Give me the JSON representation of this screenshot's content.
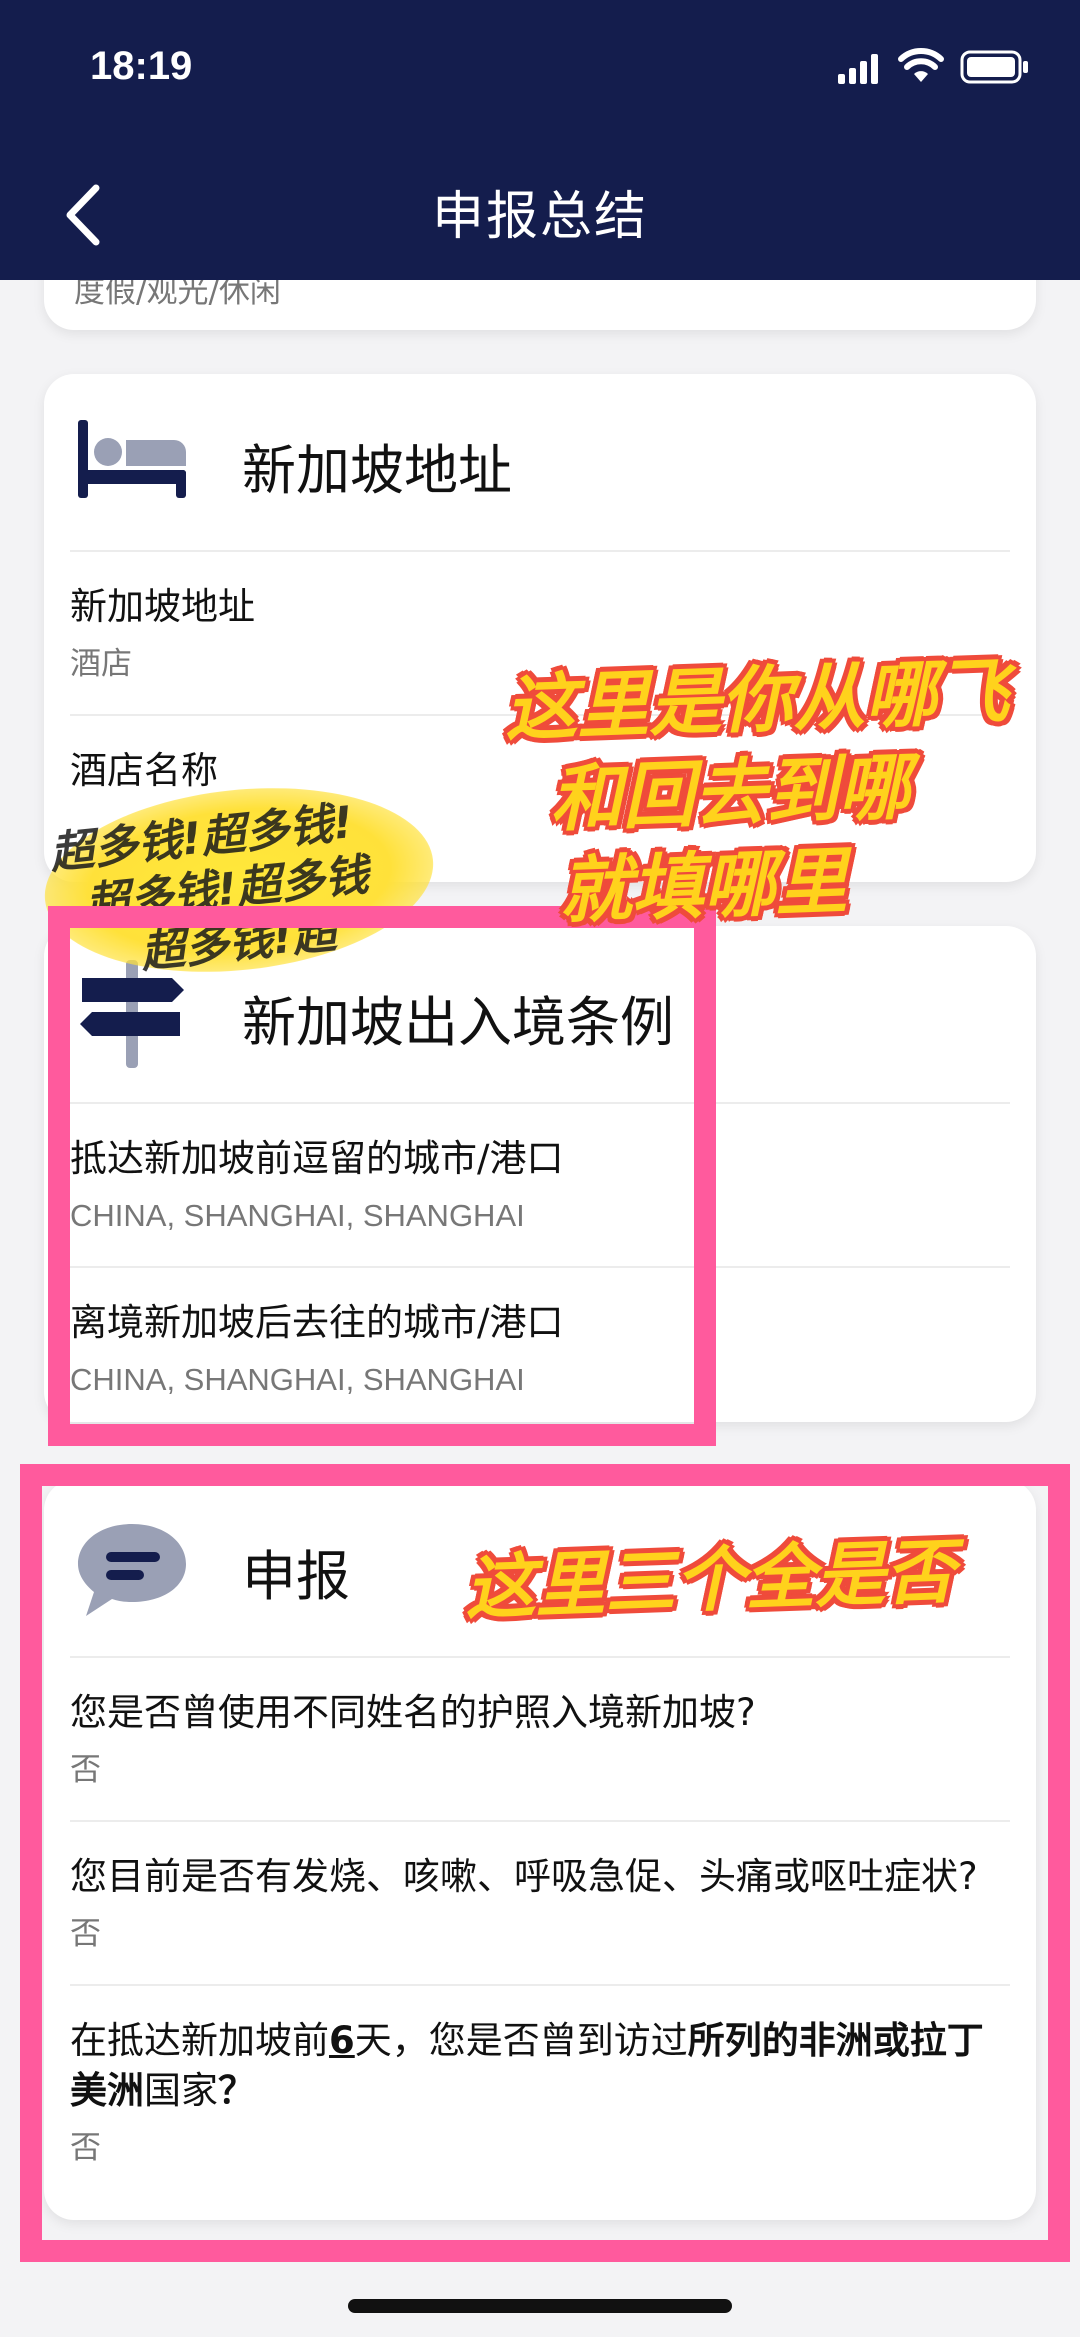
{
  "status_bar": {
    "time": "18:19"
  },
  "header": {
    "title": "申报总结"
  },
  "top_card": {
    "partial_value": "度假/观光/休闲"
  },
  "address_card": {
    "title": "新加坡地址",
    "fields": [
      {
        "label": "新加坡地址",
        "value": "酒店"
      },
      {
        "label": "酒店名称",
        "value": ""
      }
    ]
  },
  "immigration_card": {
    "title": "新加坡出入境条例",
    "fields": [
      {
        "label": "抵达新加坡前逗留的城市/港口",
        "value": "CHINA, SHANGHAI, SHANGHAI"
      },
      {
        "label": "离境新加坡后去往的城市/港口",
        "value": "CHINA, SHANGHAI, SHANGHAI"
      }
    ]
  },
  "declaration_card": {
    "title": "申报",
    "q1": {
      "label": "您是否曾使用不同姓名的护照入境新加坡?",
      "value": "否"
    },
    "q2": {
      "label": "您目前是否有发烧、咳嗽、呼吸急促、头痛或呕吐症状?",
      "value": "否"
    },
    "q3": {
      "pre": "在抵达新加坡前",
      "days": "6",
      "mid": "天，您是否曾到访过",
      "bold": "所列的非洲或拉丁美洲",
      "post": "国家",
      "mark": "？",
      "value": "否"
    }
  },
  "annotations": {
    "note1_line1": "这里是你从哪飞",
    "note1_line2": "和回去到哪",
    "note1_line3": "就填哪里",
    "note2": "这里三个全是否",
    "sticker_line1": "超多钱!超多钱!",
    "sticker_line2": "超多钱!超多钱",
    "sticker_line3": "超多钱!超"
  },
  "colors": {
    "header_bg": "#141d4d",
    "highlight_border": "#ff5a9d",
    "note_fill": "#ffd21c",
    "note_outline": "#ef4b3b",
    "icon_navy": "#141d4d",
    "icon_gray": "#9aa0b5"
  }
}
